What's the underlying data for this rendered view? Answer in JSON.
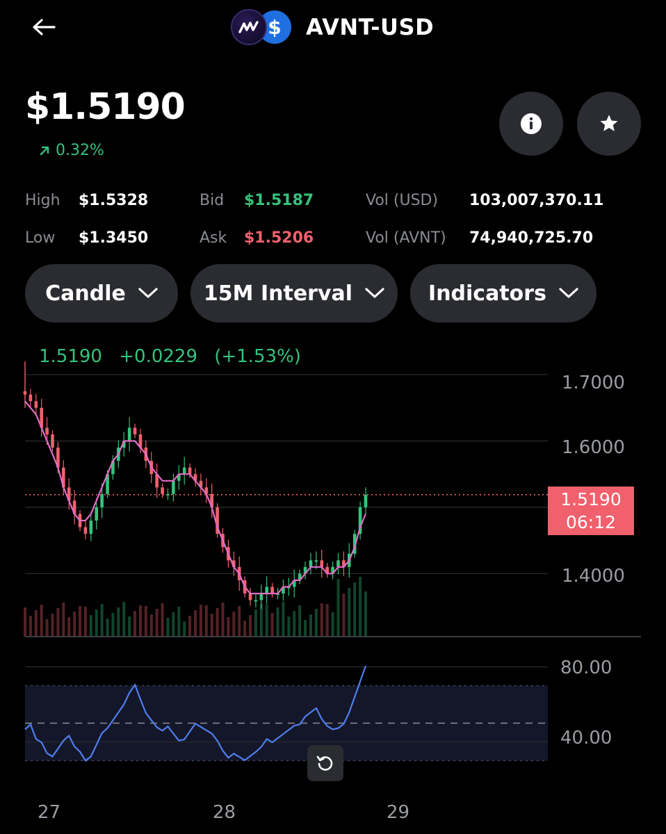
{
  "header": {
    "pair_title": "AVNT-USD",
    "base_coin_icon": "avnt-logo-icon",
    "quote_coin_icon": "usd-dollar-icon",
    "quote_coin_glyph": "$"
  },
  "price": {
    "value": "$1.5190",
    "change_pct": "0.32%",
    "change_color": "#35c37d"
  },
  "stats": {
    "high_label": "High",
    "high_value": "$1.5328",
    "low_label": "Low",
    "low_value": "$1.3450",
    "bid_label": "Bid",
    "bid_value": "$1.5187",
    "ask_label": "Ask",
    "ask_value": "$1.5206",
    "vol_usd_label": "Vol (USD)",
    "vol_usd_value": "103,007,370.11",
    "vol_avnt_label": "Vol (AVNT)",
    "vol_avnt_value": "74,940,725.70"
  },
  "controls": {
    "chart_type_label": "Candle",
    "interval_label": "15M Interval",
    "indicators_label": "Indicators"
  },
  "chart": {
    "readout_price": "1.5190",
    "readout_change": "+0.0229",
    "readout_change_pct": "(+1.53%)",
    "y_labels": [
      "1.7000",
      "1.6000",
      "1.4000"
    ],
    "last_price_tag": "1.5190",
    "countdown": "06:12",
    "indicator_y_labels": [
      "80.00",
      "40.00"
    ],
    "x_labels": [
      "27",
      "28",
      "29"
    ],
    "up_color": "#35c37d",
    "down_color": "#f0616d",
    "ma_color": "#e36cc8",
    "indicator_color": "#4f7fef"
  },
  "chart_data": {
    "type": "candlestick",
    "y_axis": {
      "ticks": [
        1.7,
        1.6,
        1.4
      ],
      "range": [
        1.305,
        1.72
      ]
    },
    "x_ticks": [
      "27",
      "28",
      "29"
    ],
    "last_price": 1.519,
    "close_series": [
      1.67,
      1.66,
      1.65,
      1.62,
      1.61,
      1.59,
      1.56,
      1.53,
      1.51,
      1.49,
      1.47,
      1.46,
      1.48,
      1.5,
      1.52,
      1.55,
      1.57,
      1.59,
      1.6,
      1.62,
      1.61,
      1.59,
      1.57,
      1.55,
      1.53,
      1.52,
      1.52,
      1.54,
      1.55,
      1.56,
      1.55,
      1.54,
      1.53,
      1.52,
      1.5,
      1.46,
      1.44,
      1.42,
      1.41,
      1.39,
      1.37,
      1.36,
      1.36,
      1.37,
      1.38,
      1.37,
      1.37,
      1.38,
      1.38,
      1.39,
      1.4,
      1.41,
      1.42,
      1.42,
      1.41,
      1.4,
      1.41,
      1.42,
      1.41,
      1.43,
      1.46,
      1.5,
      1.519
    ],
    "ma_series": [
      1.66,
      1.65,
      1.64,
      1.62,
      1.6,
      1.58,
      1.56,
      1.53,
      1.51,
      1.49,
      1.48,
      1.48,
      1.49,
      1.51,
      1.53,
      1.55,
      1.57,
      1.58,
      1.6,
      1.6,
      1.6,
      1.59,
      1.58,
      1.56,
      1.55,
      1.54,
      1.54,
      1.54,
      1.55,
      1.55,
      1.55,
      1.54,
      1.53,
      1.52,
      1.5,
      1.47,
      1.45,
      1.43,
      1.41,
      1.4,
      1.38,
      1.37,
      1.37,
      1.37,
      1.37,
      1.37,
      1.37,
      1.38,
      1.38,
      1.39,
      1.39,
      1.4,
      1.41,
      1.41,
      1.41,
      1.4,
      1.4,
      1.41,
      1.41,
      1.42,
      1.44,
      1.47,
      1.49
    ],
    "indicator": {
      "y_axis": {
        "ticks": [
          80,
          40
        ],
        "range": [
          25,
          85
        ]
      },
      "reference_lines": [
        70,
        50,
        30
      ],
      "values": [
        46,
        50,
        42,
        40,
        34,
        32,
        36,
        40,
        44,
        38,
        35,
        30,
        32,
        38,
        44,
        48,
        52,
        56,
        60,
        66,
        70,
        62,
        56,
        52,
        48,
        46,
        48,
        44,
        40,
        42,
        46,
        50,
        48,
        46,
        44,
        40,
        36,
        32,
        34,
        32,
        30,
        32,
        34,
        38,
        42,
        40,
        42,
        44,
        46,
        48,
        50,
        54,
        56,
        58,
        52,
        48,
        46,
        48,
        50,
        56,
        64,
        72,
        80
      ]
    }
  }
}
